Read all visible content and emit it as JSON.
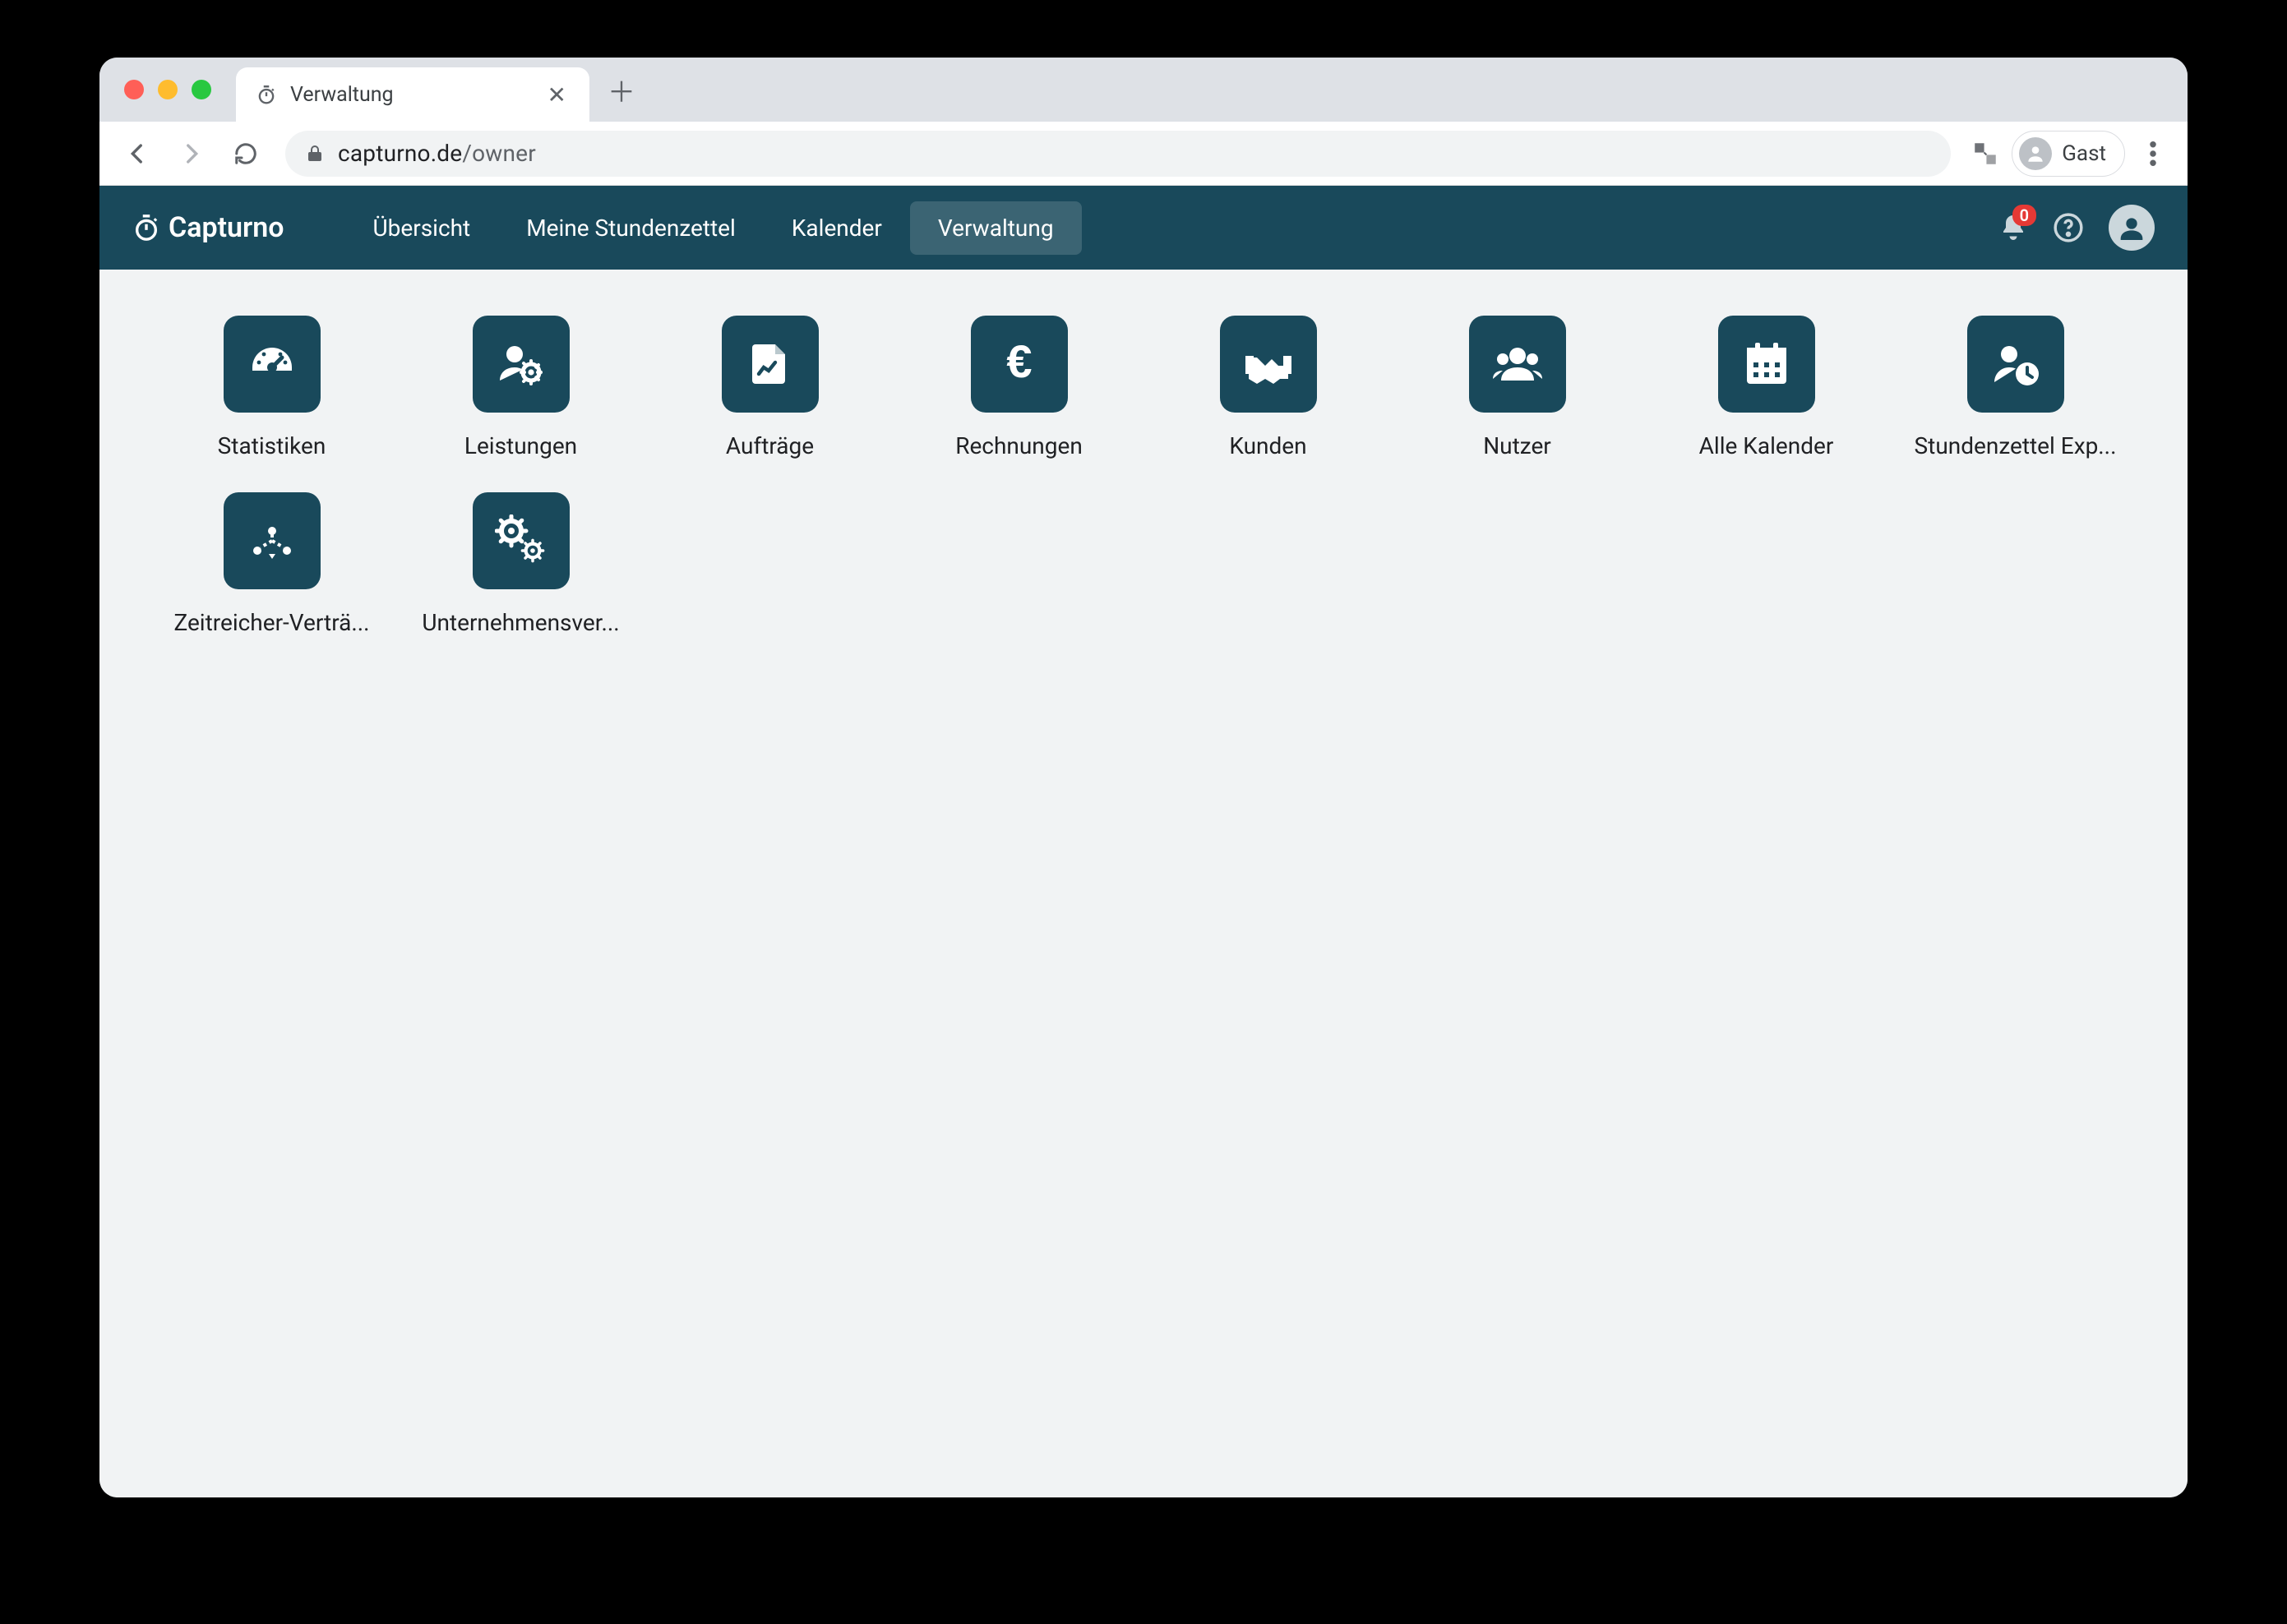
{
  "browser": {
    "tab_title": "Verwaltung",
    "url_host": "capturno.de",
    "url_path": "/owner",
    "guest_label": "Gast"
  },
  "header": {
    "brand": "Capturno",
    "nav": [
      {
        "label": "Übersicht",
        "active": false
      },
      {
        "label": "Meine Stundenzettel",
        "active": false
      },
      {
        "label": "Kalender",
        "active": false
      },
      {
        "label": "Verwaltung",
        "active": true
      }
    ],
    "notification_count": "0"
  },
  "tiles": [
    {
      "name": "tile-statistics",
      "icon": "dashboard-icon",
      "label": "Statistiken"
    },
    {
      "name": "tile-services",
      "icon": "user-cog-icon",
      "label": "Leistungen"
    },
    {
      "name": "tile-orders",
      "icon": "file-chart-icon",
      "label": "Aufträge"
    },
    {
      "name": "tile-invoices",
      "icon": "euro-icon",
      "label": "Rechnungen"
    },
    {
      "name": "tile-customers",
      "icon": "handshake-icon",
      "label": "Kunden"
    },
    {
      "name": "tile-users",
      "icon": "users-icon",
      "label": "Nutzer"
    },
    {
      "name": "tile-all-calendars",
      "icon": "calendar-icon",
      "label": "Alle Kalender"
    },
    {
      "name": "tile-timesheet-export",
      "icon": "user-clock-icon",
      "label": "Stundenzettel Exp..."
    },
    {
      "name": "tile-zeitreicher-contracts",
      "icon": "distribute-icon",
      "label": "Zeitreicher-Verträ..."
    },
    {
      "name": "tile-company-management",
      "icon": "cogs-icon",
      "label": "Unternehmensver..."
    }
  ]
}
